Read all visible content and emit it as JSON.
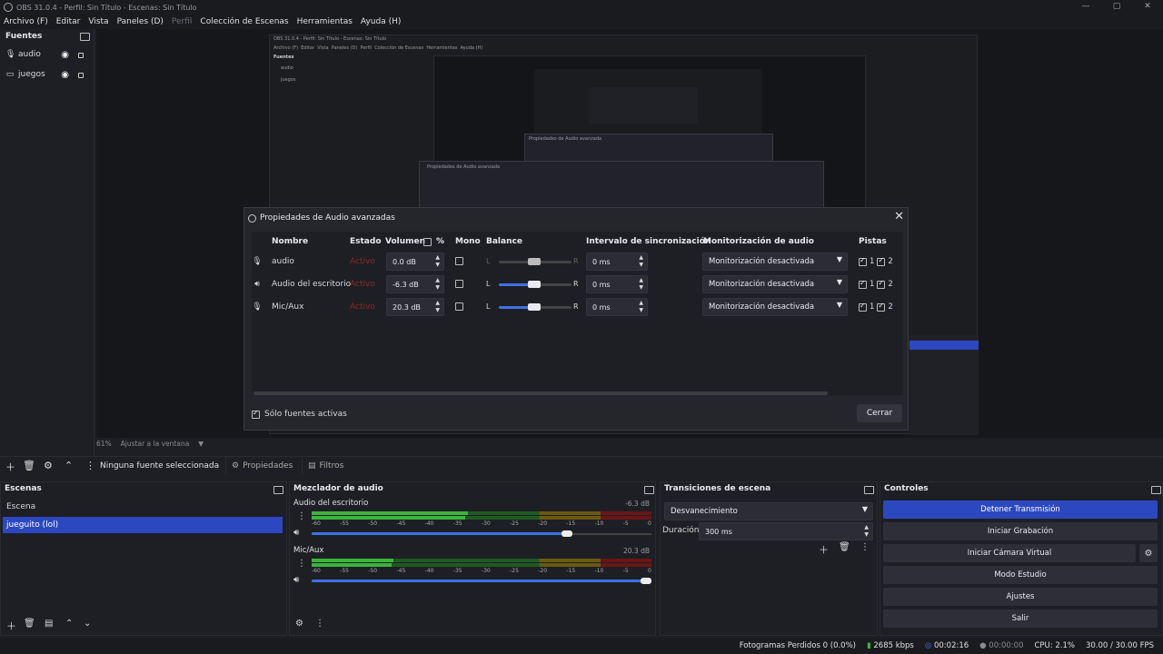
{
  "window": {
    "title": "OBS 31.0.4 - Perfil: Sin Título - Escenas: Sin Título",
    "min": "—",
    "max": "▢",
    "close": "✕"
  },
  "menu": [
    "Archivo (F)",
    "Editar",
    "Vista",
    "Paneles (D)",
    "Perfil",
    "Colección de Escenas",
    "Herramientas",
    "Ayuda (H)"
  ],
  "sources": {
    "title": "Fuentes",
    "items": [
      {
        "icon": "microphone-icon",
        "label": "audio"
      },
      {
        "icon": "display-icon",
        "label": "juegos"
      }
    ]
  },
  "nested": {
    "title": "OBS 31.0.4 - Perfil: Sin Título - Escenas: Sin Título",
    "menu": [
      "Archivo (F)",
      "Editar",
      "Vista",
      "Paneles (D)",
      "Perfil",
      "Colección de Escenas",
      "Herramientas",
      "Ayuda (H)"
    ],
    "sources_title": "Fuentes",
    "sources": [
      "audio",
      "juegos"
    ],
    "dialog2_title": "Propiedades de Audio avanzada",
    "dialog3_title": "Propiedades de Audio avanzada"
  },
  "dialog": {
    "title": "Propiedades de Audio avanzadas",
    "close_glyph": "✕",
    "headers": {
      "name": "Nombre",
      "state": "Estado",
      "volume": "Volumen",
      "percent": "%",
      "mono": "Mono",
      "balance": "Balance",
      "sync": "Intervalo de sincronización",
      "monitor": "Monitorización de audio",
      "tracks": "Pistas"
    },
    "rows": [
      {
        "icon": "microphone-icon",
        "name": "audio",
        "state": "Activo",
        "volume": "0.0 dB",
        "balance_l": "L",
        "balance_r": "R",
        "balance_value": 0.5,
        "sync": "0 ms",
        "monitor": "Monitorización desactivada",
        "track1": "1",
        "track2": "2"
      },
      {
        "icon": "speaker-icon",
        "name": "Audio del escritorio",
        "state": "Activo",
        "volume": "-6.3 dB",
        "balance_l": "L",
        "balance_r": "R",
        "balance_value": 0.5,
        "sync": "0 ms",
        "monitor": "Monitorización desactivada",
        "track1": "1",
        "track2": "2"
      },
      {
        "icon": "microphone-icon",
        "name": "Mic/Aux",
        "state": "Activo",
        "volume": "20.3 dB",
        "balance_l": "L",
        "balance_r": "R",
        "balance_value": 0.5,
        "sync": "0 ms",
        "monitor": "Monitorización desactivada",
        "track1": "1",
        "track2": "2"
      }
    ],
    "only_active": "Sólo fuentes activas",
    "close_button": "Cerrar"
  },
  "preview_status": {
    "zoom": "61%",
    "fit": "Ajustar a la ventana"
  },
  "source_toolbar": {
    "no_source": "Ninguna fuente seleccionada",
    "properties": "Propiedades",
    "filters": "Filtros"
  },
  "scenes": {
    "title": "Escenas",
    "items": [
      "Escena",
      "jueguito (lol)"
    ],
    "selected": 1
  },
  "mixer": {
    "title": "Mezclador de audio",
    "channels": [
      {
        "name": "Audio del escritorio",
        "db": "-6.3 dB",
        "level": 0.46,
        "volume": 0.75
      },
      {
        "name": "Mic/Aux",
        "db": "20.3 dB",
        "level": 0.24,
        "volume": 1.0
      }
    ],
    "scale": [
      "-60",
      "-55",
      "-50",
      "-45",
      "-40",
      "-35",
      "-30",
      "-25",
      "-20",
      "-15",
      "-10",
      "-5",
      "0"
    ]
  },
  "transitions": {
    "title": "Transiciones de escena",
    "type": "Desvanecimiento",
    "duration_label": "Duración",
    "duration": "300 ms"
  },
  "controls": {
    "title": "Controles",
    "buttons": [
      "Detener Transmisión",
      "Iniciar Grabación",
      "Iniciar Cámara Virtual",
      "Modo Estudio",
      "Ajustes",
      "Salir"
    ]
  },
  "status": {
    "dropped": "Fotogramas Perdidos 0 (0.0%)",
    "bitrate": "2685 kbps",
    "stream_time": "00:02:16",
    "rec_time": "00:00:00",
    "cpu": "CPU: 2.1%",
    "fps": "30.00 / 30.00 FPS"
  },
  "colors": {
    "accent": "#2c48c0",
    "meter_green": "#3cb43c",
    "meter_yellow": "#c8a000",
    "meter_red": "#c02828",
    "inactive_red": "#8a2a2a"
  }
}
